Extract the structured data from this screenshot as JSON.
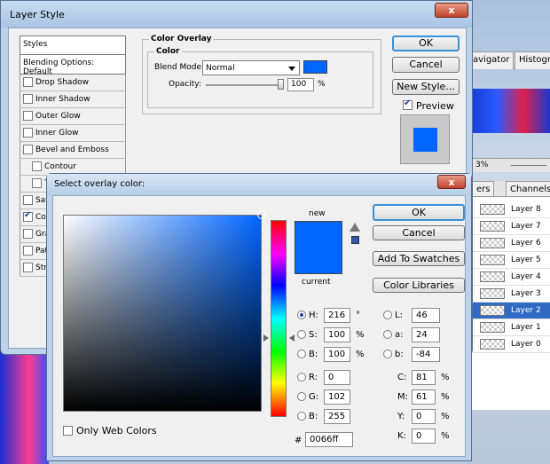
{
  "photoshop": {
    "tabs": [
      "avigator",
      "Histogr"
    ],
    "layers_tab": "ers",
    "channels_tab": "Channels",
    "zoom": "3%",
    "layers": [
      {
        "name": "Layer 8",
        "selected": false
      },
      {
        "name": "Layer 7",
        "selected": false
      },
      {
        "name": "Layer 6",
        "selected": false
      },
      {
        "name": "Layer 5",
        "selected": false
      },
      {
        "name": "Layer 4",
        "selected": false
      },
      {
        "name": "Layer 3",
        "selected": false
      },
      {
        "name": "Layer 2",
        "selected": true
      },
      {
        "name": "Layer 1",
        "selected": false
      },
      {
        "name": "Layer 0",
        "selected": false
      }
    ]
  },
  "layer_style": {
    "title": "Layer Style",
    "close": "x",
    "styles_header": "Styles",
    "blending_options": "Blending Options: Default",
    "items": [
      {
        "label": "Drop Shadow",
        "checked": false,
        "indent": false
      },
      {
        "label": "Inner Shadow",
        "checked": false,
        "indent": false
      },
      {
        "label": "Outer Glow",
        "checked": false,
        "indent": false
      },
      {
        "label": "Inner Glow",
        "checked": false,
        "indent": false
      },
      {
        "label": "Bevel and Emboss",
        "checked": false,
        "indent": false
      },
      {
        "label": "Contour",
        "checked": false,
        "indent": true
      },
      {
        "label": "T",
        "checked": false,
        "indent": true
      },
      {
        "label": "Sati",
        "checked": false,
        "indent": false
      },
      {
        "label": "Colo",
        "checked": true,
        "indent": false
      },
      {
        "label": "Grad",
        "checked": false,
        "indent": false
      },
      {
        "label": "Patt",
        "checked": false,
        "indent": false
      },
      {
        "label": "Stro",
        "checked": false,
        "indent": false
      }
    ],
    "group_title": "Color Overlay",
    "sub_group_title": "Color",
    "blend_mode_label": "Blend Mode:",
    "blend_mode_value": "Normal",
    "overlay_color": "#0066ff",
    "opacity_label": "Opacity:",
    "opacity_value": "100",
    "opacity_unit": "%",
    "ok": "OK",
    "cancel": "Cancel",
    "new_style": "New Style...",
    "preview_label": "Preview",
    "preview_checked": true
  },
  "color_picker": {
    "title": "Select overlay color:",
    "close": "x",
    "new_label": "new",
    "current_label": "current",
    "new_color": "#0066ff",
    "current_color": "#0066ff",
    "ok": "OK",
    "cancel": "Cancel",
    "add_to_swatches": "Add To Swatches",
    "color_libraries": "Color Libraries",
    "only_web_colors": "Only Web Colors",
    "hue_fraction": 0.6,
    "hsb": [
      {
        "label": "H:",
        "value": "216",
        "unit": "°",
        "selected": true
      },
      {
        "label": "S:",
        "value": "100",
        "unit": "%",
        "selected": false
      },
      {
        "label": "B:",
        "value": "100",
        "unit": "%",
        "selected": false
      }
    ],
    "rgb": [
      {
        "label": "R:",
        "value": "0"
      },
      {
        "label": "G:",
        "value": "102"
      },
      {
        "label": "B:",
        "value": "255"
      }
    ],
    "lab": [
      {
        "label": "L:",
        "value": "46"
      },
      {
        "label": "a:",
        "value": "24"
      },
      {
        "label": "b:",
        "value": "-84"
      }
    ],
    "cmyk": [
      {
        "label": "C:",
        "value": "81",
        "unit": "%"
      },
      {
        "label": "M:",
        "value": "61",
        "unit": "%"
      },
      {
        "label": "Y:",
        "value": "0",
        "unit": "%"
      },
      {
        "label": "K:",
        "value": "0",
        "unit": "%"
      }
    ],
    "hex_label": "#",
    "hex_value": "0066ff"
  }
}
